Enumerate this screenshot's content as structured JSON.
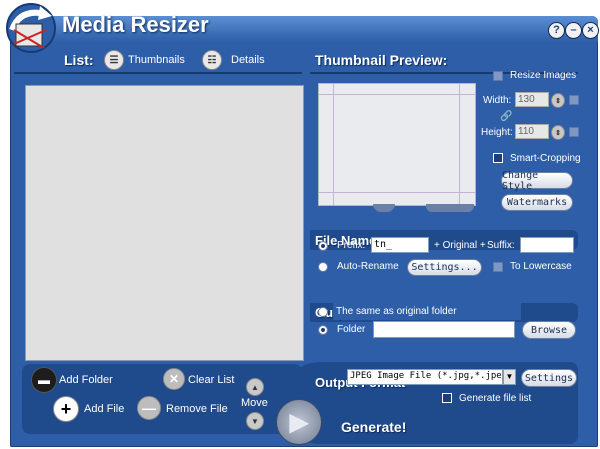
{
  "window": {
    "title": "Media Resizer",
    "help": "?",
    "minimize": "–",
    "close": "×"
  },
  "list": {
    "label": "List:",
    "thumbnails_label": "Thumbnails",
    "details_label": "Details"
  },
  "preview": {
    "title": "Thumbnail Preview:"
  },
  "resize": {
    "resize_label": "Resize Images",
    "width_label": "Width:",
    "width_value": "130",
    "height_label": "Height:",
    "height_value": "110",
    "smart_crop_label": "Smart-Cropping",
    "change_style": "Change Style",
    "watermarks": "Watermarks"
  },
  "file_name": {
    "title": "File Name",
    "prefix_label": "Prefix:",
    "prefix_value": "tn_",
    "original_label": "+ Original +",
    "suffix_label": "Suffix:",
    "suffix_value": "",
    "auto_rename": "Auto-Rename",
    "settings": "Settings...",
    "lowercase": "To Lowercase"
  },
  "output_folder": {
    "title": "Output Folder",
    "same_as_original": "The same as original folder",
    "folder_label": "Folder",
    "folder_value": "",
    "browse": "Browse"
  },
  "output_format": {
    "title": "Output Format",
    "format_value": "JPEG Image File (*.jpg,*.jpe",
    "settings": "Settings",
    "generate_list": "Generate file list"
  },
  "actions": {
    "add_folder": "Add Folder",
    "add_file": "Add File",
    "clear_list": "Clear List",
    "remove_file": "Remove File",
    "move": "Move",
    "generate": "Generate!"
  }
}
